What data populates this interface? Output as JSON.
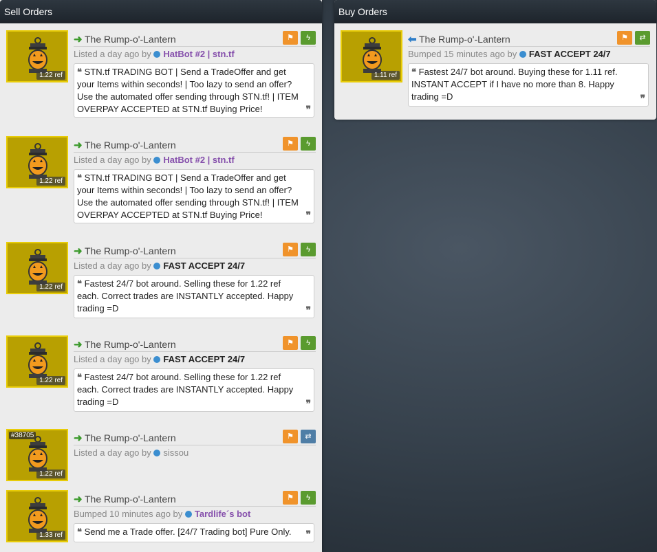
{
  "sell": {
    "title": "Sell Orders",
    "listings": [
      {
        "name": "The Rump-o'-Lantern",
        "price": "1.22 ref",
        "status": "Listed a day ago by",
        "user": "HatBot #2 | stn.tf",
        "desc": "STN.tf TRADING BOT | Send a TradeOffer and get your Items within seconds! | Too lazy to send an offer? Use the automated offer sending through STN.tf! | ITEM OVERPAY ACCEPTED at STN.tf Buying Price!"
      },
      {
        "name": "The Rump-o'-Lantern",
        "price": "1.22 ref",
        "status": "Listed a day ago by",
        "user": "HatBot #2 | stn.tf",
        "desc": "STN.tf TRADING BOT | Send a TradeOffer and get your Items within seconds! | Too lazy to send an offer? Use the automated offer sending through STN.tf! | ITEM OVERPAY ACCEPTED at STN.tf Buying Price!"
      },
      {
        "name": "The Rump-o'-Lantern",
        "price": "1.22 ref",
        "status": "Listed a day ago by",
        "user": "FAST ACCEPT 24/7",
        "desc": "Fastest 24/7 bot around. Selling these for 1.22 ref each. Correct trades are INSTANTLY accepted. Happy trading =D"
      },
      {
        "name": "The Rump-o'-Lantern",
        "price": "1.22 ref",
        "status": "Listed a day ago by",
        "user": "FAST ACCEPT 24/7",
        "desc": "Fastest 24/7 bot around. Selling these for 1.22 ref each. Correct trades are INSTANTLY accepted. Happy trading =D"
      },
      {
        "name": "The Rump-o'-Lantern",
        "price": "1.22 ref",
        "serial": "#38705",
        "status": "Listed a day ago by",
        "user": "sissou"
      },
      {
        "name": "The Rump-o'-Lantern",
        "price": "1.33 ref",
        "status": "Bumped 10 minutes ago by",
        "user": "Tardlife´s bot",
        "desc": "Send me a Trade offer. [24/7 Trading bot] Pure Only."
      }
    ]
  },
  "buy": {
    "title": "Buy Orders",
    "listings": [
      {
        "name": "The Rump-o'-Lantern",
        "price": "1.11 ref",
        "status": "Bumped 15 minutes ago by",
        "user": "FAST ACCEPT 24/7",
        "desc": "Fastest 24/7 bot around. Buying these for 1.11 ref. INSTANT ACCEPT if I have no more than 8. Happy trading =D"
      }
    ]
  },
  "icons": {
    "sell_arrow": "arrow-right-icon",
    "buy_arrow": "arrow-left-icon",
    "report": "flag-icon",
    "instant": "lightning-icon",
    "negotiate": "swap-icon",
    "quote_open": "quote-open-icon",
    "quote_close": "quote-close-icon"
  },
  "colors": {
    "item_border": "#e8cc08",
    "flag_button": "#f0932b",
    "bolt_button": "#5a9b2f",
    "swap_button": "#4f7ea6",
    "sell_arrow": "#3c9a2c",
    "buy_arrow": "#2e7ec9",
    "user_link": "#8650ac"
  }
}
